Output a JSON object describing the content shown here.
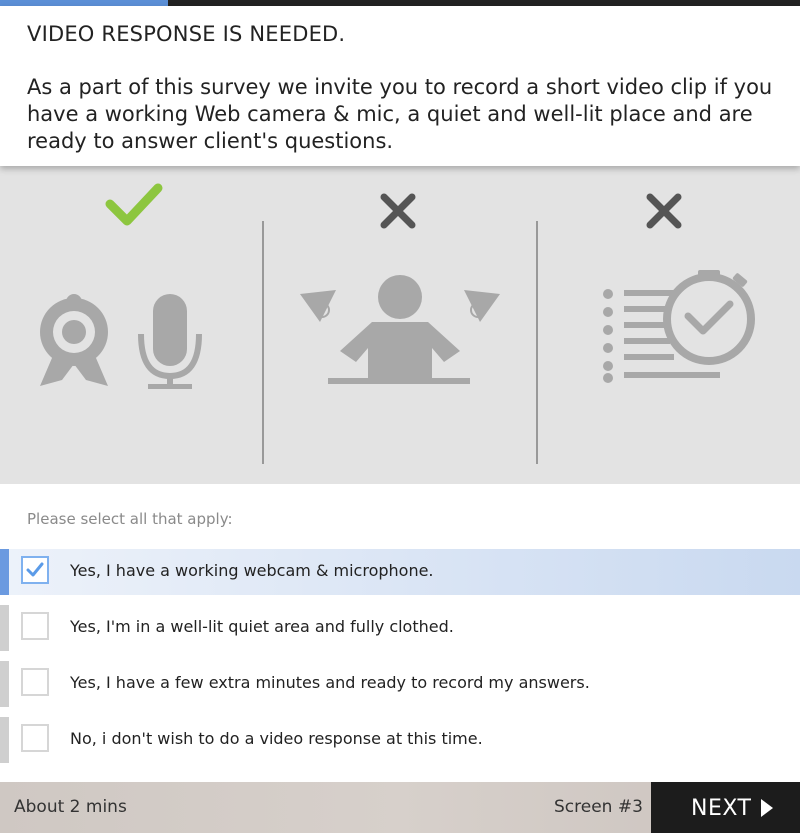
{
  "progress": {
    "fraction": 0.21
  },
  "header": {
    "title": "VIDEO RESPONSE IS NEEDED.",
    "body": "As a part of this survey we invite you to record a short video clip if you have a working Web camera & mic, a quiet and well-lit place and are ready to answer client's questions."
  },
  "illustration": {
    "panels": [
      {
        "status": "check",
        "icons": [
          "webcam-icon",
          "microphone-icon"
        ]
      },
      {
        "status": "cross",
        "icons": [
          "person-lighting-icon"
        ]
      },
      {
        "status": "cross",
        "icons": [
          "stopwatch-list-icon"
        ]
      }
    ],
    "colors": {
      "check": "#8dc63f",
      "cross": "#555555",
      "icon": "#a8a8a8"
    }
  },
  "prompt": "Please select all that apply:",
  "options": [
    {
      "label": "Yes, I have a working webcam & microphone.",
      "checked": true
    },
    {
      "label": "Yes, I'm in a well-lit quiet area and fully clothed.",
      "checked": false
    },
    {
      "label": "Yes, I have a few extra minutes and ready to record my answers.",
      "checked": false
    },
    {
      "label": "No, i don't wish to do a video response at this time.",
      "checked": false
    }
  ],
  "footer": {
    "time_estimate": "About 2 mins",
    "screen_label": "Screen #3",
    "next_label": "NEXT"
  },
  "colors": {
    "accent": "#5b8fd6",
    "selected_bar": "#6b9ae0",
    "next_bg": "#1c1c1c"
  }
}
